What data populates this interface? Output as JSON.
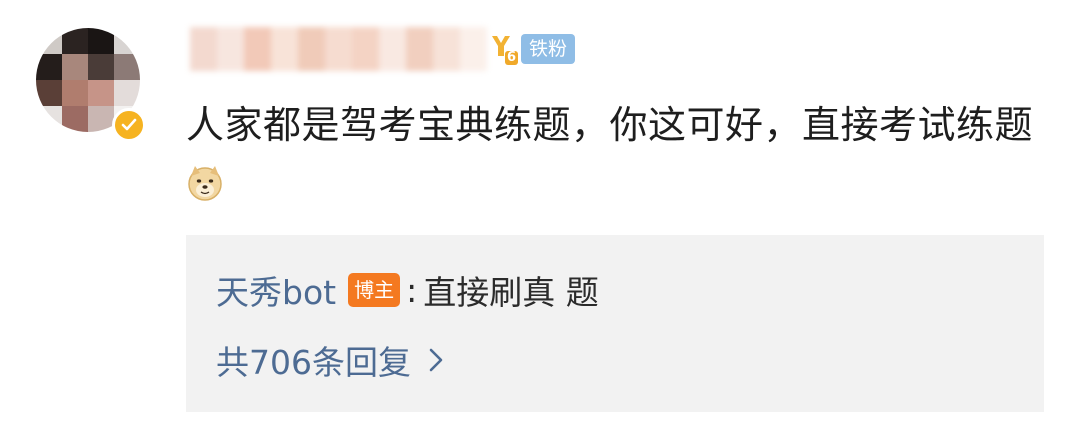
{
  "comment": {
    "level_badge_number": "6",
    "fan_badge_label": "铁粉",
    "text": "人家都是驾考宝典练题，你这可好，直接考试练题",
    "emoji_icon": "doge-emoji-icon",
    "verified_icon": "verified-check-icon",
    "accent_color": "#f6b321"
  },
  "reply": {
    "author": "天秀bot",
    "author_badge": "博主",
    "colon": ":",
    "text": "直接刷真 题",
    "count_label": "共706条回复",
    "link_color": "#4d6b93",
    "badge_color": "#f47920"
  }
}
